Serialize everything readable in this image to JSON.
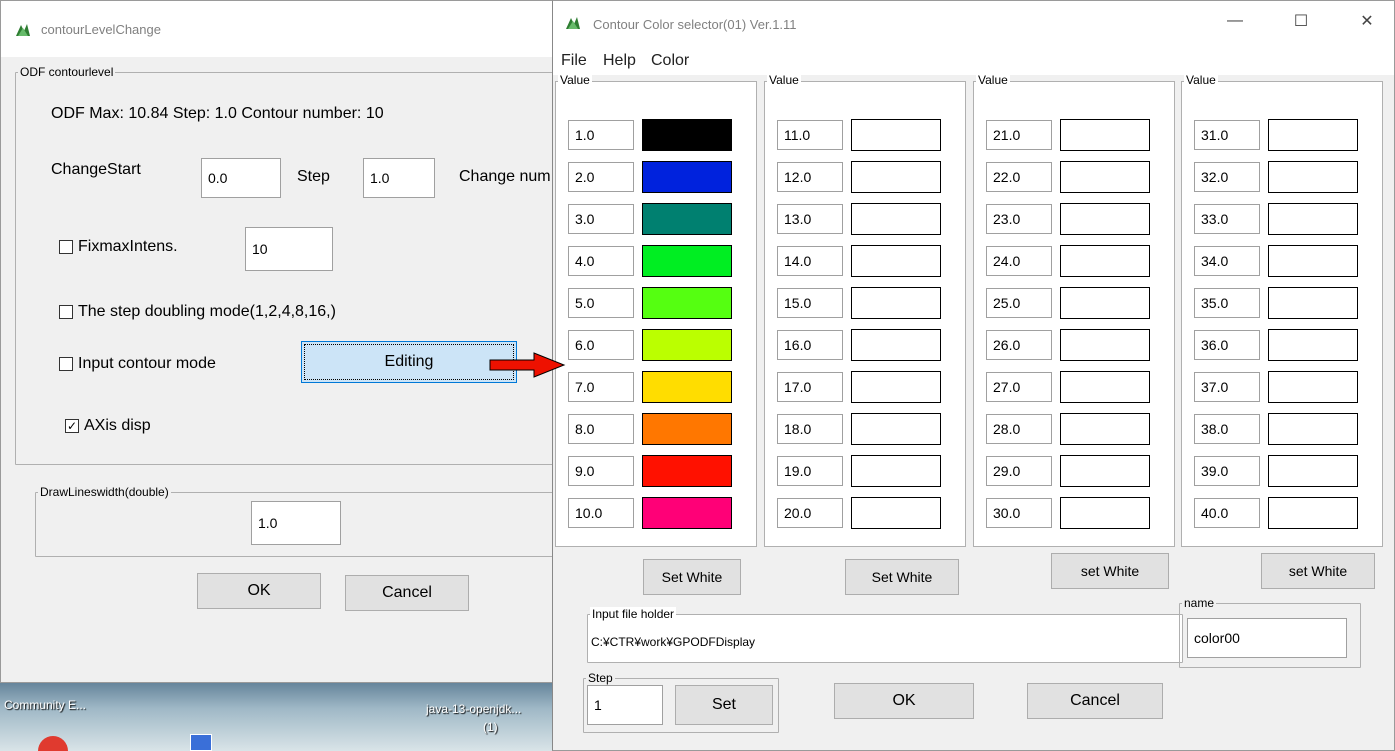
{
  "desktop": {
    "icons": [
      {
        "label": "Community E..."
      },
      {
        "label": "java-13-openjdk..."
      },
      {
        "label": "(1)"
      }
    ]
  },
  "left_window": {
    "title": "contourLevelChange",
    "group_title": "ODF contourlevel",
    "info_text": "ODF Max: 10.84 Step: 1.0 Contour number: 10",
    "change_start_label": "ChangeStart",
    "change_start_value": "0.0",
    "step_label": "Step",
    "step_value": "1.0",
    "change_num_label": "Change num",
    "fixmax_label": "FixmaxIntens.",
    "fixmax_checked": false,
    "fixmax_value": "10",
    "doubling_label": "The step doubling mode(1,2,4,8,16,)",
    "doubling_checked": false,
    "input_contour_label": "Input contour mode",
    "input_contour_checked": false,
    "editing_button": "Editing",
    "axis_label": "AXis disp",
    "axis_checked": true,
    "linewidth_group": "DrawLineswidth(double)",
    "linewidth_value": "1.0",
    "ok_button": "OK",
    "cancel_button": "Cancel"
  },
  "right_window": {
    "title": "Contour Color selector(01) Ver.1.11",
    "menu": [
      "File",
      "Help",
      "Color"
    ],
    "columns": [
      {
        "legend": "Value",
        "set_button": "Set White",
        "rows": [
          {
            "value": "1.0",
            "color": "#000000"
          },
          {
            "value": "2.0",
            "color": "#0022dd"
          },
          {
            "value": "3.0",
            "color": "#008070"
          },
          {
            "value": "4.0",
            "color": "#00ee22"
          },
          {
            "value": "5.0",
            "color": "#55ff11"
          },
          {
            "value": "6.0",
            "color": "#bbff00"
          },
          {
            "value": "7.0",
            "color": "#ffdd00"
          },
          {
            "value": "8.0",
            "color": "#ff7700"
          },
          {
            "value": "9.0",
            "color": "#ff1100"
          },
          {
            "value": "10.0",
            "color": "#ff0077"
          }
        ]
      },
      {
        "legend": "Value",
        "set_button": "Set White",
        "rows": [
          {
            "value": "11.0",
            "color": "#ffffff"
          },
          {
            "value": "12.0",
            "color": "#ffffff"
          },
          {
            "value": "13.0",
            "color": "#ffffff"
          },
          {
            "value": "14.0",
            "color": "#ffffff"
          },
          {
            "value": "15.0",
            "color": "#ffffff"
          },
          {
            "value": "16.0",
            "color": "#ffffff"
          },
          {
            "value": "17.0",
            "color": "#ffffff"
          },
          {
            "value": "18.0",
            "color": "#ffffff"
          },
          {
            "value": "19.0",
            "color": "#ffffff"
          },
          {
            "value": "20.0",
            "color": "#ffffff"
          }
        ]
      },
      {
        "legend": "Value",
        "set_button": "set White",
        "rows": [
          {
            "value": "21.0",
            "color": "#ffffff"
          },
          {
            "value": "22.0",
            "color": "#ffffff"
          },
          {
            "value": "23.0",
            "color": "#ffffff"
          },
          {
            "value": "24.0",
            "color": "#ffffff"
          },
          {
            "value": "25.0",
            "color": "#ffffff"
          },
          {
            "value": "26.0",
            "color": "#ffffff"
          },
          {
            "value": "27.0",
            "color": "#ffffff"
          },
          {
            "value": "28.0",
            "color": "#ffffff"
          },
          {
            "value": "29.0",
            "color": "#ffffff"
          },
          {
            "value": "30.0",
            "color": "#ffffff"
          }
        ]
      },
      {
        "legend": "Value",
        "set_button": "set White",
        "rows": [
          {
            "value": "31.0",
            "color": "#ffffff"
          },
          {
            "value": "32.0",
            "color": "#ffffff"
          },
          {
            "value": "33.0",
            "color": "#ffffff"
          },
          {
            "value": "34.0",
            "color": "#ffffff"
          },
          {
            "value": "35.0",
            "color": "#ffffff"
          },
          {
            "value": "36.0",
            "color": "#ffffff"
          },
          {
            "value": "37.0",
            "color": "#ffffff"
          },
          {
            "value": "38.0",
            "color": "#ffffff"
          },
          {
            "value": "39.0",
            "color": "#ffffff"
          },
          {
            "value": "40.0",
            "color": "#ffffff"
          }
        ]
      }
    ],
    "input_file_group": "Input file holder",
    "input_file_path": "C:¥CTR¥work¥GPODFDisplay",
    "name_group": "name",
    "name_value": "color00",
    "step_group": "Step",
    "step_value": "1",
    "step_set_button": "Set",
    "ok_button": "OK",
    "cancel_button": "Cancel",
    "caption_icons": [
      "minimize-icon",
      "maximize-icon",
      "close-icon"
    ]
  },
  "colors": {
    "editing_button_bg": "#cce4f7",
    "arrow": "#ee1100",
    "app_icon_green": "#2e7d32"
  }
}
